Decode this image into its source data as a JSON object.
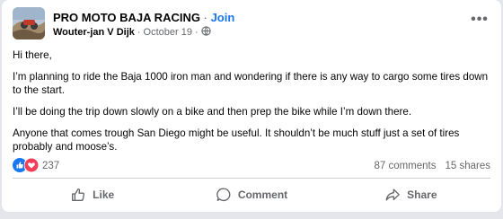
{
  "post": {
    "group_name": "PRO MOTO BAJA RACING",
    "separator": "·",
    "join_label": "Join",
    "author": "Wouter-jan V Dijk",
    "meta_separator": "·",
    "date": "October 19",
    "meta_separator2": "·",
    "audience_icon": "globe-icon",
    "more_label": "•••",
    "paragraphs": [
      "Hi there,",
      "I’m planning to ride the Baja 1000 iron man and wondering if there is any way to cargo some tires down to the start.",
      "I’ll be doing the trip down slowly on a bike and then prep the bike while I’m down there.",
      "Anyone that comes trough San Diego might be useful. It shouldn’t be much stuff just a set of tires probably and moose’s."
    ]
  },
  "stats": {
    "reaction_count": "237",
    "comments": "87 comments",
    "shares": "15 shares",
    "reaction_types": [
      "like-reaction-icon",
      "love-reaction-icon"
    ]
  },
  "actions": {
    "like_label": "Like",
    "comment_label": "Comment",
    "share_label": "Share"
  },
  "colors": {
    "accent": "#1877f2",
    "love": "#f33e58",
    "secondary_text": "#65676b",
    "primary_text": "#050505"
  }
}
